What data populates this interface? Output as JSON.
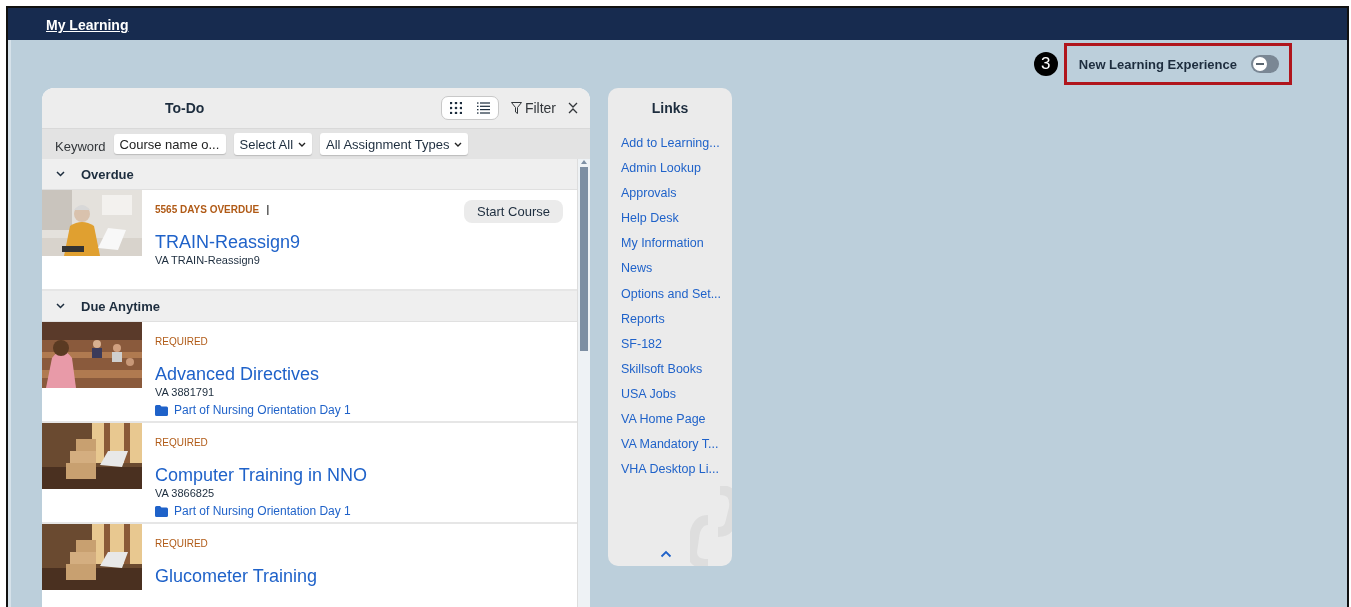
{
  "header": {
    "title": "My Learning"
  },
  "experience_toggle": {
    "callout": "3",
    "label": "New Learning Experience",
    "on": false
  },
  "todo": {
    "title": "To-Do",
    "filter_label": "Filter",
    "keyword_label": "Keyword",
    "keyword_placeholder": "Course name o...",
    "status_select": "Select All",
    "type_select": "All Assignment Types",
    "groups": [
      {
        "title": "Overdue",
        "expanded": true,
        "items": [
          {
            "status": "5565 DAYS OVERDUE",
            "separator": "|",
            "title": "TRAIN-Reassign9",
            "code": "VA TRAIN-Reassign9",
            "action": "Start Course"
          }
        ]
      },
      {
        "title": "Due Anytime",
        "expanded": true,
        "items": [
          {
            "status": "REQUIRED",
            "title": "Advanced Directives",
            "code": "VA 3881791",
            "program": "Part of Nursing Orientation Day 1"
          },
          {
            "status": "REQUIRED",
            "title": "Computer Training in NNO",
            "code": "VA 3866825",
            "program": "Part of Nursing Orientation Day 1"
          },
          {
            "status": "REQUIRED",
            "title": "Glucometer Training"
          }
        ]
      }
    ]
  },
  "links": {
    "title": "Links",
    "items": [
      "Add to Learning...",
      "Admin Lookup",
      "Approvals",
      "Help Desk",
      "My Information",
      "News",
      "Options and Set...",
      "Reports",
      "SF-182",
      "Skillsoft Books",
      "USA Jobs",
      "VA Home Page",
      "VA Mandatory T...",
      "VHA Desktop Li..."
    ]
  }
}
